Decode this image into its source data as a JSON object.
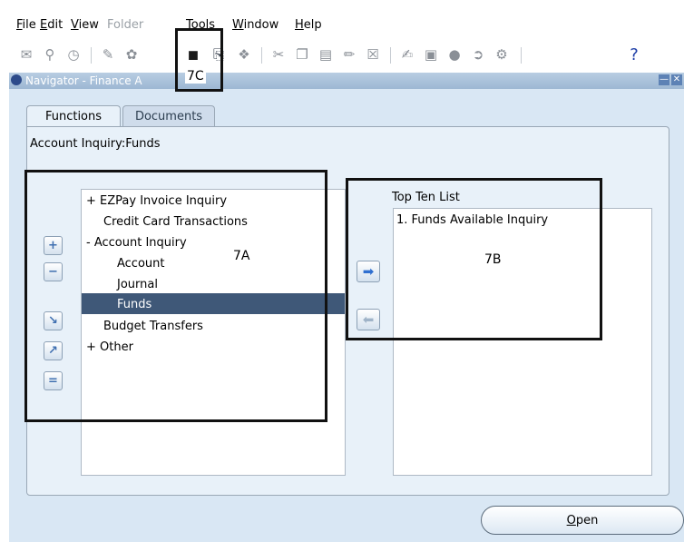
{
  "menu": {
    "items": [
      {
        "label": "File",
        "ul": "F",
        "rest": "ile",
        "enabled": true
      },
      {
        "label": "Edit",
        "ul": "E",
        "rest": "dit",
        "enabled": true
      },
      {
        "label": "View",
        "ul": "V",
        "rest": "iew",
        "enabled": true
      },
      {
        "label": "Folder",
        "ul": "",
        "rest": "Folder",
        "enabled": false
      },
      {
        "label": "Tools",
        "ul": "T",
        "rest": "ools",
        "enabled": true
      },
      {
        "label": "Window",
        "ul": "W",
        "rest": "indow",
        "enabled": true
      },
      {
        "label": "Help",
        "ul": "H",
        "rest": "elp",
        "enabled": true
      }
    ]
  },
  "toolbar": {
    "icons": [
      "new-icon",
      "find-icon",
      "navigator-icon",
      "save-icon",
      "print-icon",
      "flashlight-icon",
      "printer-icon",
      "close-form-icon",
      "cut-icon",
      "copy-icon",
      "paste-icon",
      "clear-record-icon",
      "delete-record-icon",
      "edit-field-icon",
      "zoom-icon",
      "translations-icon",
      "attachments-icon",
      "folder-tools-icon",
      "help-icon"
    ],
    "help_glyph": "?"
  },
  "window": {
    "title": "Navigator - Finance A"
  },
  "tabs": [
    {
      "label": "Functions",
      "active": true
    },
    {
      "label": "Documents",
      "active": false
    }
  ],
  "breadcrumb": "Account Inquiry:Funds",
  "function_tree": {
    "items": [
      {
        "prefix": "+",
        "label": "EZPay Invoice Inquiry",
        "level": 0
      },
      {
        "prefix": "",
        "label": "Credit Card Transactions",
        "level": 0
      },
      {
        "prefix": "-",
        "label": "Account Inquiry",
        "level": 0
      },
      {
        "prefix": "",
        "label": "Account",
        "level": 1
      },
      {
        "prefix": "",
        "label": "Journal",
        "level": 1
      },
      {
        "prefix": "",
        "label": "Funds",
        "level": 1,
        "selected": true
      },
      {
        "prefix": "",
        "label": "Budget Transfers",
        "level": 0
      },
      {
        "prefix": "+",
        "label": "Other",
        "level": 0
      }
    ]
  },
  "top_ten": {
    "label": "Top Ten List",
    "items": [
      "1. Funds Available Inquiry"
    ]
  },
  "buttons": {
    "open": "Open",
    "open_ul": "O",
    "open_rest": "pen"
  },
  "callouts": {
    "a": "7A",
    "b": "7B",
    "c": "7C"
  },
  "colors": {
    "selection": "#3f5878",
    "title_bar": "#9db7d3",
    "window_bg": "#d9e7f4"
  }
}
